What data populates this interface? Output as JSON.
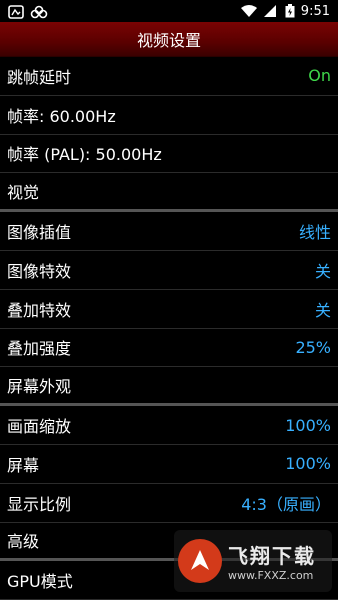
{
  "status": {
    "time": "9:51",
    "icons": [
      "notification-icon",
      "cloud-icon",
      "wifi-icon",
      "signal-icon",
      "battery-icon"
    ]
  },
  "header": {
    "title": "视频设置"
  },
  "rows": [
    {
      "label": "跳帧延时",
      "value": "On",
      "value_color": "green"
    },
    {
      "label": "帧率: 60.00Hz",
      "value": ""
    },
    {
      "label": "帧率 (PAL): 50.00Hz",
      "value": ""
    },
    {
      "label": "视觉",
      "value": "",
      "section": true
    },
    {
      "label": "图像插值",
      "value": "线性",
      "value_color": "blue"
    },
    {
      "label": "图像特效",
      "value": "关",
      "value_color": "blue"
    },
    {
      "label": "叠加特效",
      "value": "关",
      "value_color": "blue"
    },
    {
      "label": "叠加强度",
      "value": "25%",
      "value_color": "blue"
    },
    {
      "label": "屏幕外观",
      "value": "",
      "section": true
    },
    {
      "label": "画面缩放",
      "value": "100%",
      "value_color": "blue"
    },
    {
      "label": "屏幕",
      "value": "100%",
      "value_color": "blue"
    },
    {
      "label": "显示比例",
      "value": "4:3（原画）",
      "value_color": "blue"
    },
    {
      "label": "高级",
      "value": "",
      "section": true
    },
    {
      "label": "GPU模式",
      "value": ""
    }
  ],
  "watermark": {
    "title": "飞翔下载",
    "url": "www.FXXZ.com"
  },
  "colors": {
    "header": "#6a0202",
    "green": "#3fd64a",
    "blue": "#38b0ff"
  }
}
